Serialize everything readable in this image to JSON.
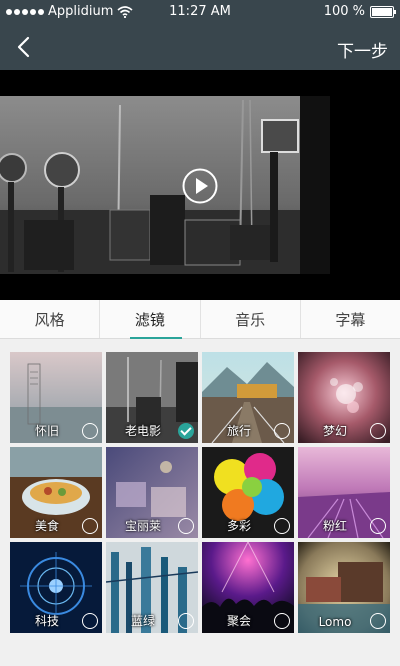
{
  "status_bar": {
    "carrier": "Applidium",
    "time": "11:27 AM",
    "battery_text": "100 %"
  },
  "nav": {
    "next_label": "下一步"
  },
  "tabs": [
    {
      "label": "风格",
      "active": false
    },
    {
      "label": "滤镜",
      "active": true
    },
    {
      "label": "音乐",
      "active": false
    },
    {
      "label": "字幕",
      "active": false
    }
  ],
  "filters": [
    {
      "label": "怀旧",
      "selected": false
    },
    {
      "label": "老电影",
      "selected": true
    },
    {
      "label": "旅行",
      "selected": false
    },
    {
      "label": "梦幻",
      "selected": false
    },
    {
      "label": "美食",
      "selected": false
    },
    {
      "label": "宝丽莱",
      "selected": false
    },
    {
      "label": "多彩",
      "selected": false
    },
    {
      "label": "粉红",
      "selected": false
    },
    {
      "label": "科技",
      "selected": false
    },
    {
      "label": "蓝绿",
      "selected": false
    },
    {
      "label": "聚会",
      "selected": false
    },
    {
      "label": "Lomo",
      "selected": false
    }
  ],
  "colors": {
    "bar": "#39464d",
    "accent": "#2aa49a"
  }
}
